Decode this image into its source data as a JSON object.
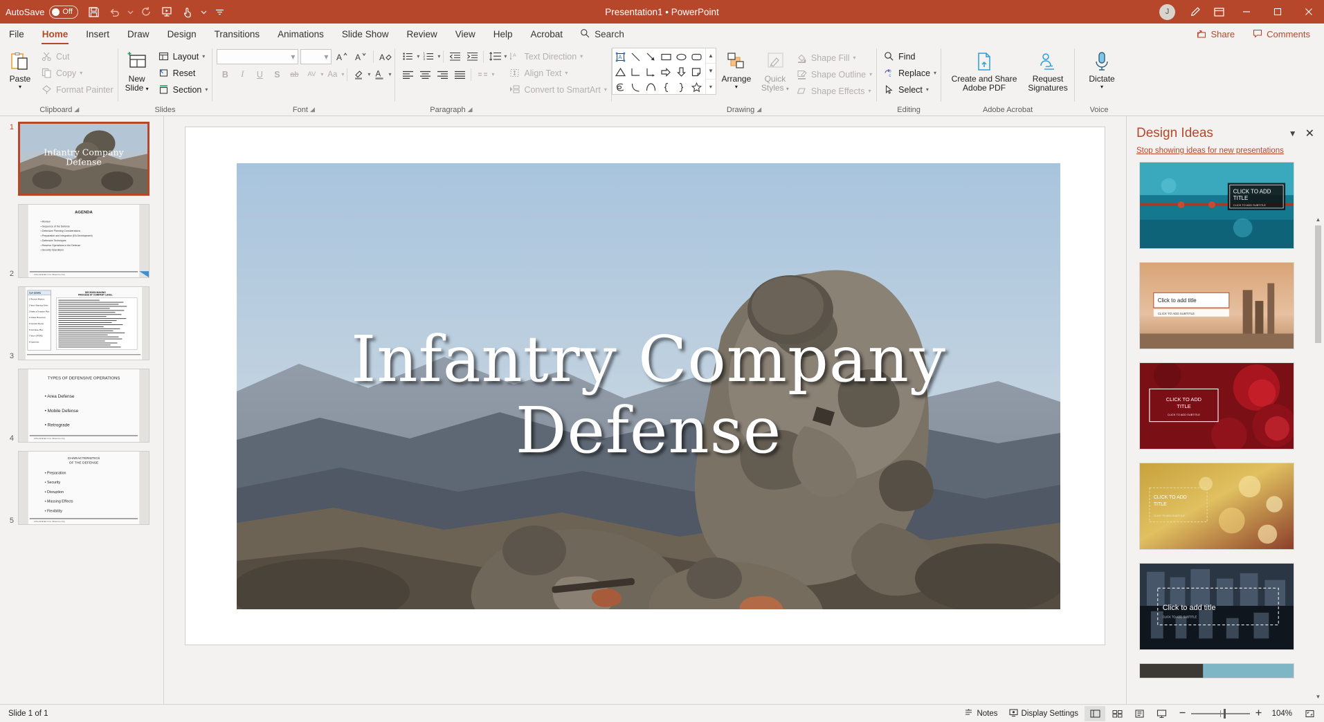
{
  "titlebar": {
    "autosave_label": "AutoSave",
    "autosave_state": "Off",
    "document_title": "Presentation1",
    "app_name": "PowerPoint",
    "title_separator": "  •  ",
    "avatar_initial": "J",
    "qat": [
      {
        "name": "save-icon",
        "tooltip": "Save"
      },
      {
        "name": "undo-icon",
        "tooltip": "Undo"
      },
      {
        "name": "redo-icon",
        "tooltip": "Repeat"
      },
      {
        "name": "start-from-beginning-icon",
        "tooltip": "Start From Beginning"
      },
      {
        "name": "touch-mode-icon",
        "tooltip": "Touch/Mouse Mode"
      },
      {
        "name": "customize-qat-icon",
        "tooltip": "Customize Quick Access Toolbar"
      }
    ],
    "window_buttons": [
      "minimize",
      "restore",
      "close"
    ]
  },
  "tabs": [
    {
      "label": "File",
      "active": false
    },
    {
      "label": "Home",
      "active": true
    },
    {
      "label": "Insert",
      "active": false
    },
    {
      "label": "Draw",
      "active": false
    },
    {
      "label": "Design",
      "active": false
    },
    {
      "label": "Transitions",
      "active": false
    },
    {
      "label": "Animations",
      "active": false
    },
    {
      "label": "Slide Show",
      "active": false
    },
    {
      "label": "Review",
      "active": false
    },
    {
      "label": "View",
      "active": false
    },
    {
      "label": "Help",
      "active": false
    },
    {
      "label": "Acrobat",
      "active": false
    }
  ],
  "search": {
    "placeholder": "Search",
    "label": "Search"
  },
  "tab_right": {
    "share_label": "Share",
    "comments_label": "Comments"
  },
  "ribbon": {
    "groups": [
      {
        "label": "Clipboard"
      },
      {
        "label": "Slides"
      },
      {
        "label": "Font"
      },
      {
        "label": "Paragraph"
      },
      {
        "label": "Drawing"
      },
      {
        "label": "Editing"
      },
      {
        "label": "Adobe Acrobat"
      },
      {
        "label": "Voice"
      }
    ],
    "clipboard": {
      "paste_label": "Paste",
      "cut_label": "Cut",
      "copy_label": "Copy",
      "format_painter_label": "Format Painter"
    },
    "slides": {
      "new_slide_line1": "New",
      "new_slide_line2": "Slide",
      "layout_label": "Layout",
      "reset_label": "Reset",
      "section_label": "Section"
    },
    "font": {
      "font_name_value": "",
      "font_size_value": "",
      "grow_font": "A",
      "shrink_font": "A",
      "clear_formatting": "A",
      "bold": "B",
      "italic": "I",
      "underline": "U",
      "shadow": "S",
      "strikethrough": "ab",
      "character_spacing": "AV",
      "change_case": "Aa"
    },
    "paragraph": {
      "text_direction_label": "Text Direction",
      "align_text_label": "Align Text",
      "convert_to_smartart_label": "Convert to SmartArt"
    },
    "drawing": {
      "arrange_label": "Arrange",
      "quick_styles_line1": "Quick",
      "quick_styles_line2": "Styles",
      "shape_fill_label": "Shape Fill",
      "shape_outline_label": "Shape Outline",
      "shape_effects_label": "Shape Effects",
      "shapes": [
        "text-box-shape",
        "line-shape",
        "arrow-shape",
        "rectangle-shape",
        "oval-shape",
        "rounded-rectangle-shape",
        "triangle-shape",
        "elbow-connector-shape",
        "elbow-arrow-connector-shape",
        "right-arrow-shape",
        "down-arrow-shape",
        "folded-corner-shape",
        "scribble-shape",
        "curve-shape",
        "arc-shape",
        "left-brace-shape",
        "right-brace-shape",
        "star-shape"
      ]
    },
    "editing": {
      "find_label": "Find",
      "replace_label": "Replace",
      "select_label": "Select"
    },
    "acrobat": {
      "create_share_line1": "Create and Share",
      "create_share_line2": "Adobe PDF",
      "request_sig_line1": "Request",
      "request_sig_line2": "Signatures"
    },
    "voice": {
      "dictate_label": "Dictate"
    }
  },
  "thumbnails": [
    {
      "number": "1",
      "selected": true,
      "title": "Infantry Company Defense",
      "kind": "title-slide"
    },
    {
      "number": "2",
      "selected": false,
      "title": "AGENDA",
      "kind": "bullets",
      "bullets": [
        "Review",
        "Sequence of the Defense",
        "Defensive Planning Considerations",
        "Preparation and Integration (EA Development)",
        "Defensive Techniques",
        "Reserve Operations in the Defense",
        "Security Operations"
      ]
    },
    {
      "number": "3",
      "selected": false,
      "title": "DECISION MAKING PROCESS AT COMPANY LEVEL",
      "kind": "dense-table",
      "sidebar_title": "TLP STEPS",
      "steps": [
        "1  Receive Mission",
        "2  Issue Warning Order",
        "3  Make a Tentative Plan",
        "4  Initiate Movement",
        "5  Conduct Recon",
        "6  Complete Plan",
        "7  Issue OPORD",
        "8  Supervise"
      ]
    },
    {
      "number": "4",
      "selected": false,
      "title": "TYPES OF DEFENSIVE OPERATIONS",
      "kind": "bullets",
      "bullets": [
        "Area Defense",
        "Mobile Defense",
        "Retrograde"
      ]
    },
    {
      "number": "5",
      "selected": false,
      "title": "CHARACTERISTICS OF THE DEFENSE",
      "kind": "bullets",
      "bullets": [
        "Preparation",
        "Security",
        "Disruption",
        "Massing Effects",
        "Flexibility"
      ]
    }
  ],
  "slide": {
    "title_line1": "Infantry Company",
    "title_line2": "Defense",
    "image_alt": "soldiers-on-rocky-hillside-photo"
  },
  "design_ideas": {
    "panel_title": "Design Ideas",
    "stop_link": "Stop showing ideas for new presentations",
    "ideas": [
      {
        "name": "idea-teal-bokeh",
        "label_line1": "CLICK TO ADD",
        "label_line2": "TITLE",
        "sub": "CLICK TO ADD SUBTITLE",
        "theme": "teal"
      },
      {
        "name": "idea-sunset-industrial",
        "label_line1": "Click to add title",
        "label_line2": "",
        "sub": "CLICK TO ADD SUBTITLE",
        "theme": "sunset"
      },
      {
        "name": "idea-red-roses",
        "label_line1": "CLICK TO ADD",
        "label_line2": "TITLE",
        "sub": "CLICK TO ADD SUBTITLE",
        "theme": "roses"
      },
      {
        "name": "idea-gold-bokeh",
        "label_line1": "CLICK TO ADD",
        "label_line2": "TITLE",
        "sub": "CLICK TO ADD SUBTITLE",
        "theme": "gold"
      },
      {
        "name": "idea-architecture",
        "label_line1": "Click to add title",
        "label_line2": "",
        "sub": "CLICK TO ADD SUBTITLE",
        "theme": "architecture"
      },
      {
        "name": "idea-dark-strip",
        "label_line1": "",
        "label_line2": "",
        "sub": "",
        "theme": "dark"
      }
    ]
  },
  "statusbar": {
    "slide_count": "Slide 1 of 1",
    "notes_label": "Notes",
    "display_settings_label": "Display Settings",
    "zoom_value": "104%",
    "views": [
      "normal-view",
      "slide-sorter-view",
      "reading-view",
      "slide-show-view"
    ]
  },
  "colors": {
    "accent": "#b7472a",
    "ribbon_bg": "#f3f2f1",
    "panel_bg": "#f3f2f1",
    "border": "#d2d0ce"
  }
}
